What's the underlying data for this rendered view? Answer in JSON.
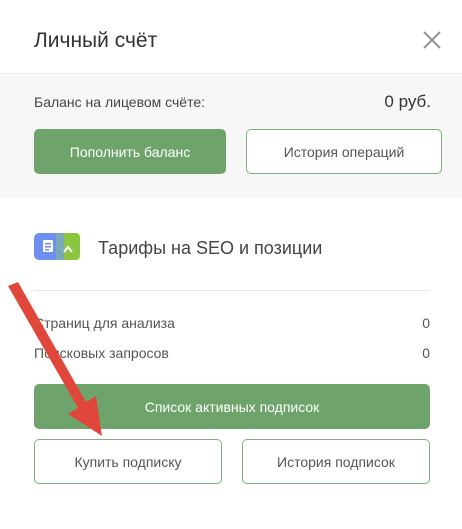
{
  "header": {
    "title": "Личный счёт",
    "close_icon": "close-icon"
  },
  "balance": {
    "label": "Баланс на лицевом счёте:",
    "value": "0 руб.",
    "topup_button": "Пополнить баланс",
    "history_button": "История операций"
  },
  "tariffs": {
    "title": "Тарифы на SEO и позиции",
    "icon": "tariff-icon",
    "stats": [
      {
        "label": "Страниц для анализа",
        "value": "0"
      },
      {
        "label": "Поисковых запросов",
        "value": "0"
      }
    ],
    "active_subscriptions_button": "Список активных подписок",
    "buy_button": "Купить подписку",
    "subscription_history_button": "История подписок"
  },
  "colors": {
    "accent_green": "#6fa36c",
    "outline_green": "#7fb27a",
    "balance_bg": "#f7f7f7",
    "icon_blue": "#6e8ff0",
    "icon_green": "#8cc63f",
    "arrow_red": "#e0473a"
  }
}
